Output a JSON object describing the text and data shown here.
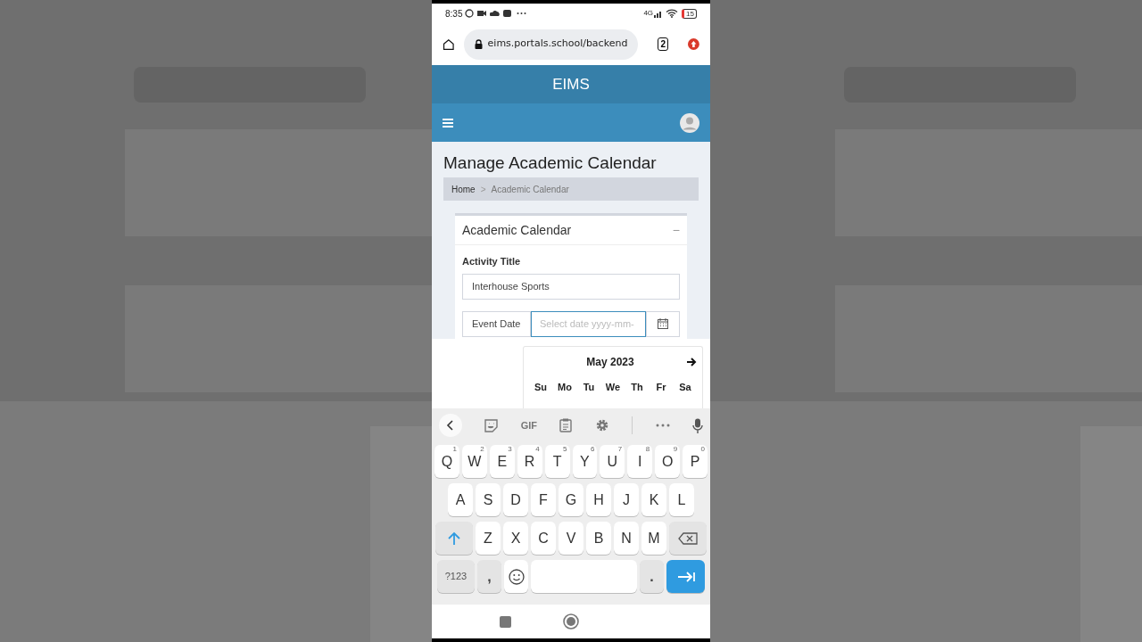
{
  "status_bar": {
    "time": "8:35",
    "network": "4G",
    "battery": "15"
  },
  "browser": {
    "url": "eims.portals.school/backend",
    "tab_count": "2"
  },
  "app": {
    "title": "EIMS"
  },
  "page": {
    "title": "Manage Academic Calendar",
    "breadcrumb": [
      "Home",
      "Academic Calendar"
    ],
    "separator": ">"
  },
  "card": {
    "title": "Academic Calendar",
    "collapse": "−",
    "activity_title": {
      "label": "Activity Title",
      "value": "Interhouse Sports"
    },
    "event_date": {
      "label": "Event Date",
      "placeholder": "Select date yyyy-mm-"
    }
  },
  "datepicker": {
    "month": "May 2023",
    "weekdays": [
      "Su",
      "Mo",
      "Tu",
      "We",
      "Th",
      "Fr",
      "Sa"
    ]
  },
  "keyboard": {
    "toolbar_gif": "GIF",
    "rows": [
      [
        {
          "label": "Q",
          "hint": "1"
        },
        {
          "label": "W",
          "hint": "2"
        },
        {
          "label": "E",
          "hint": "3"
        },
        {
          "label": "R",
          "hint": "4"
        },
        {
          "label": "T",
          "hint": "5"
        },
        {
          "label": "Y",
          "hint": "6"
        },
        {
          "label": "U",
          "hint": "7"
        },
        {
          "label": "I",
          "hint": "8"
        },
        {
          "label": "O",
          "hint": "9"
        },
        {
          "label": "P",
          "hint": "0"
        }
      ],
      [
        {
          "label": "A"
        },
        {
          "label": "S"
        },
        {
          "label": "D"
        },
        {
          "label": "F"
        },
        {
          "label": "G"
        },
        {
          "label": "H"
        },
        {
          "label": "J"
        },
        {
          "label": "K"
        },
        {
          "label": "L"
        }
      ],
      [
        {
          "kind": "shift"
        },
        {
          "label": "Z"
        },
        {
          "label": "X"
        },
        {
          "label": "C"
        },
        {
          "label": "V"
        },
        {
          "label": "B"
        },
        {
          "label": "N"
        },
        {
          "label": "M"
        },
        {
          "kind": "backspace"
        }
      ]
    ],
    "bottom_row": {
      "symbols": "?123",
      "comma": ",",
      "period": "."
    }
  }
}
